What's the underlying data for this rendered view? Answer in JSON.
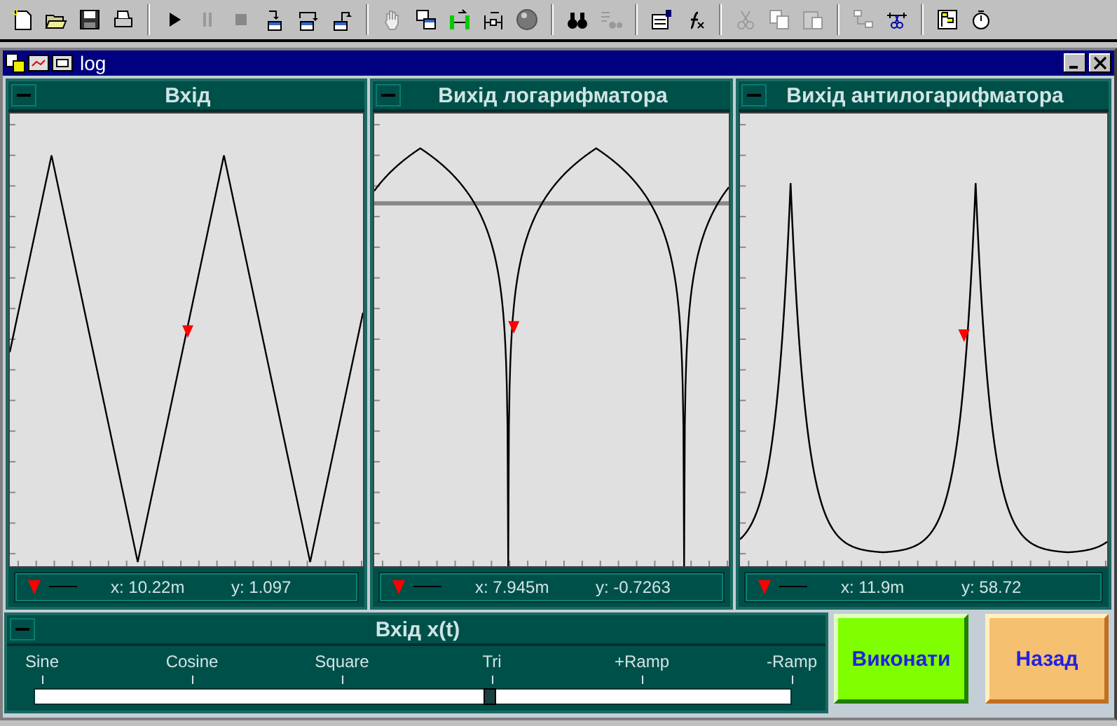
{
  "window": {
    "title": "log"
  },
  "graphs": [
    {
      "title": "Вхід",
      "kind": "triangle",
      "cursor": {
        "x": "x: 10.22m",
        "y": "y: 1.097"
      }
    },
    {
      "title": "Вихід логарифматора",
      "kind": "log",
      "cursor": {
        "x": "x: 7.945m",
        "y": "y: -0.7263"
      }
    },
    {
      "title": "Вихід антилогарифматора",
      "kind": "antilog",
      "cursor": {
        "x": "x: 11.9m",
        "y": "y: 58.72"
      }
    }
  ],
  "input_panel": {
    "title": "Вхід x(t)",
    "options": [
      "Sine",
      "Cosine",
      "Square",
      "Tri",
      "+Ramp",
      "-Ramp"
    ],
    "level": 0.6
  },
  "buttons": [
    {
      "label": "Виконати",
      "color": "#80ff00"
    },
    {
      "label": "Назад",
      "color": "#f5c070"
    }
  ]
}
